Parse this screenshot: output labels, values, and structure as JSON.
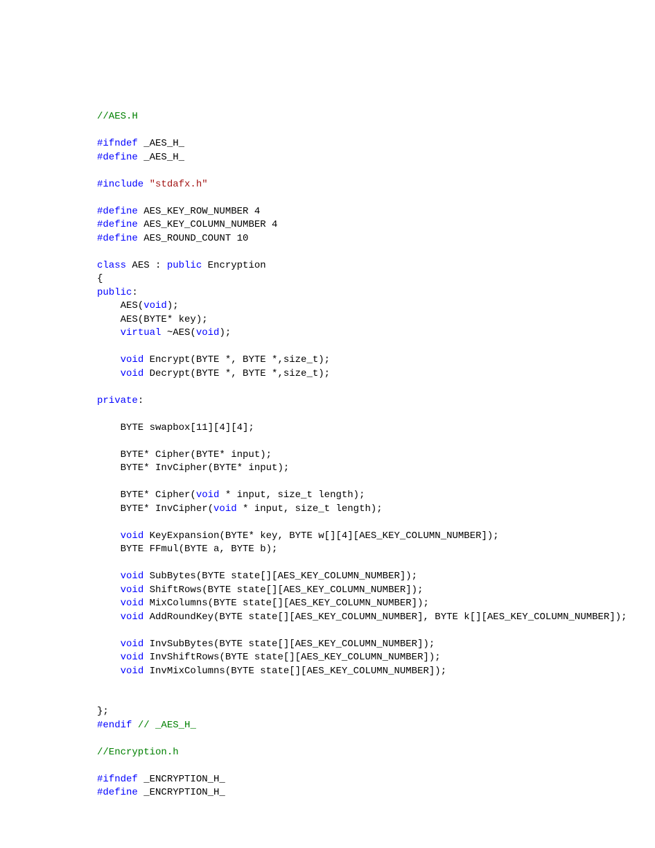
{
  "code": {
    "lines": [
      [
        {
          "cls": "c-comment",
          "t": "//AES.H"
        }
      ],
      [],
      [
        {
          "cls": "c-pp",
          "t": "#ifndef"
        },
        {
          "cls": "c-plain",
          "t": " _AES_H_"
        }
      ],
      [
        {
          "cls": "c-pp",
          "t": "#define"
        },
        {
          "cls": "c-plain",
          "t": " _AES_H_"
        }
      ],
      [],
      [
        {
          "cls": "c-pp",
          "t": "#include"
        },
        {
          "cls": "c-plain",
          "t": " "
        },
        {
          "cls": "c-str",
          "t": "\"stdafx.h\""
        }
      ],
      [],
      [
        {
          "cls": "c-pp",
          "t": "#define"
        },
        {
          "cls": "c-plain",
          "t": " AES_KEY_ROW_NUMBER 4"
        }
      ],
      [
        {
          "cls": "c-pp",
          "t": "#define"
        },
        {
          "cls": "c-plain",
          "t": " AES_KEY_COLUMN_NUMBER 4"
        }
      ],
      [
        {
          "cls": "c-pp",
          "t": "#define"
        },
        {
          "cls": "c-plain",
          "t": " AES_ROUND_COUNT 10"
        }
      ],
      [],
      [
        {
          "cls": "c-kw",
          "t": "class"
        },
        {
          "cls": "c-plain",
          "t": " AES : "
        },
        {
          "cls": "c-kw",
          "t": "public"
        },
        {
          "cls": "c-plain",
          "t": " Encryption"
        }
      ],
      [
        {
          "cls": "c-plain",
          "t": "{"
        }
      ],
      [
        {
          "cls": "c-kw",
          "t": "public"
        },
        {
          "cls": "c-plain",
          "t": ":"
        }
      ],
      [
        {
          "cls": "c-plain",
          "t": "    AES("
        },
        {
          "cls": "c-kw",
          "t": "void"
        },
        {
          "cls": "c-plain",
          "t": ");"
        }
      ],
      [
        {
          "cls": "c-plain",
          "t": "    AES(BYTE* key);"
        }
      ],
      [
        {
          "cls": "c-plain",
          "t": "    "
        },
        {
          "cls": "c-kw",
          "t": "virtual"
        },
        {
          "cls": "c-plain",
          "t": " ~AES("
        },
        {
          "cls": "c-kw",
          "t": "void"
        },
        {
          "cls": "c-plain",
          "t": ");"
        }
      ],
      [],
      [
        {
          "cls": "c-plain",
          "t": "    "
        },
        {
          "cls": "c-kw",
          "t": "void"
        },
        {
          "cls": "c-plain",
          "t": " Encrypt(BYTE *, BYTE *,size_t);"
        }
      ],
      [
        {
          "cls": "c-plain",
          "t": "    "
        },
        {
          "cls": "c-kw",
          "t": "void"
        },
        {
          "cls": "c-plain",
          "t": " Decrypt(BYTE *, BYTE *,size_t);"
        }
      ],
      [],
      [
        {
          "cls": "c-kw",
          "t": "private"
        },
        {
          "cls": "c-plain",
          "t": ":"
        }
      ],
      [],
      [
        {
          "cls": "c-plain",
          "t": "    BYTE swapbox[11][4][4];"
        }
      ],
      [],
      [
        {
          "cls": "c-plain",
          "t": "    BYTE* Cipher(BYTE* input);"
        }
      ],
      [
        {
          "cls": "c-plain",
          "t": "    BYTE* InvCipher(BYTE* input);"
        }
      ],
      [],
      [
        {
          "cls": "c-plain",
          "t": "    BYTE* Cipher("
        },
        {
          "cls": "c-kw",
          "t": "void"
        },
        {
          "cls": "c-plain",
          "t": " * input, size_t length);"
        }
      ],
      [
        {
          "cls": "c-plain",
          "t": "    BYTE* InvCipher("
        },
        {
          "cls": "c-kw",
          "t": "void"
        },
        {
          "cls": "c-plain",
          "t": " * input, size_t length);"
        }
      ],
      [],
      [
        {
          "cls": "c-plain",
          "t": "    "
        },
        {
          "cls": "c-kw",
          "t": "void"
        },
        {
          "cls": "c-plain",
          "t": " KeyExpansion(BYTE* key, BYTE w[][4][AES_KEY_COLUMN_NUMBER]);"
        }
      ],
      [
        {
          "cls": "c-plain",
          "t": "    BYTE FFmul(BYTE a, BYTE b);"
        }
      ],
      [],
      [
        {
          "cls": "c-plain",
          "t": "    "
        },
        {
          "cls": "c-kw",
          "t": "void"
        },
        {
          "cls": "c-plain",
          "t": " SubBytes(BYTE state[][AES_KEY_COLUMN_NUMBER]);"
        }
      ],
      [
        {
          "cls": "c-plain",
          "t": "    "
        },
        {
          "cls": "c-kw",
          "t": "void"
        },
        {
          "cls": "c-plain",
          "t": " ShiftRows(BYTE state[][AES_KEY_COLUMN_NUMBER]);"
        }
      ],
      [
        {
          "cls": "c-plain",
          "t": "    "
        },
        {
          "cls": "c-kw",
          "t": "void"
        },
        {
          "cls": "c-plain",
          "t": " MixColumns(BYTE state[][AES_KEY_COLUMN_NUMBER]);"
        }
      ],
      [
        {
          "cls": "c-plain",
          "t": "    "
        },
        {
          "cls": "c-kw",
          "t": "void"
        },
        {
          "cls": "c-plain",
          "t": " AddRoundKey(BYTE state[][AES_KEY_COLUMN_NUMBER], BYTE k[][AES_KEY_COLUMN_NUMBER]);"
        }
      ],
      [],
      [
        {
          "cls": "c-plain",
          "t": "    "
        },
        {
          "cls": "c-kw",
          "t": "void"
        },
        {
          "cls": "c-plain",
          "t": " InvSubBytes(BYTE state[][AES_KEY_COLUMN_NUMBER]);"
        }
      ],
      [
        {
          "cls": "c-plain",
          "t": "    "
        },
        {
          "cls": "c-kw",
          "t": "void"
        },
        {
          "cls": "c-plain",
          "t": " InvShiftRows(BYTE state[][AES_KEY_COLUMN_NUMBER]);"
        }
      ],
      [
        {
          "cls": "c-plain",
          "t": "    "
        },
        {
          "cls": "c-kw",
          "t": "void"
        },
        {
          "cls": "c-plain",
          "t": " InvMixColumns(BYTE state[][AES_KEY_COLUMN_NUMBER]);"
        }
      ],
      [],
      [],
      [
        {
          "cls": "c-plain",
          "t": "};"
        }
      ],
      [
        {
          "cls": "c-pp",
          "t": "#endif"
        },
        {
          "cls": "c-plain",
          "t": " "
        },
        {
          "cls": "c-comment",
          "t": "// _AES_H_"
        }
      ],
      [],
      [
        {
          "cls": "c-comment",
          "t": "//Encryption.h"
        }
      ],
      [],
      [
        {
          "cls": "c-pp",
          "t": "#ifndef"
        },
        {
          "cls": "c-plain",
          "t": " _ENCRYPTION_H_"
        }
      ],
      [
        {
          "cls": "c-pp",
          "t": "#define"
        },
        {
          "cls": "c-plain",
          "t": " _ENCRYPTION_H_"
        }
      ]
    ]
  }
}
